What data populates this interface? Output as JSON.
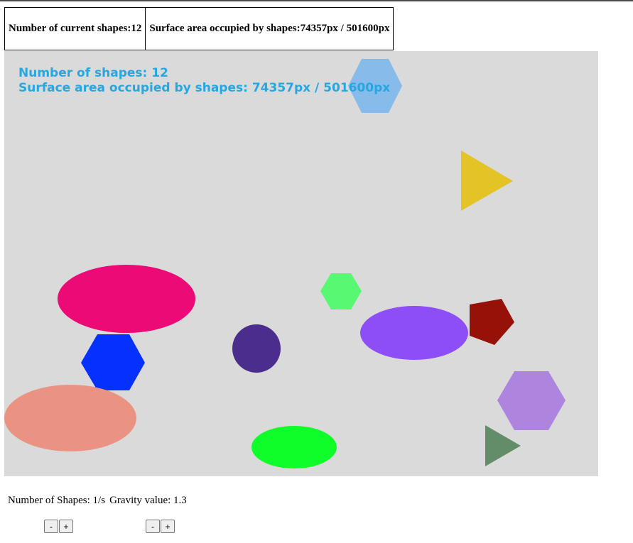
{
  "stats": {
    "shapes_label": "Number of current shapes:",
    "shapes_value": "12",
    "area_label": "Surface area occupied by shapes:",
    "area_value": "74357px / 501600px"
  },
  "overlay": {
    "line1": "Number of shapes: 12",
    "line2": "Surface area occupied by shapes: 74357px / 501600px"
  },
  "colors": {
    "canvas_background": "#dadada",
    "overlay_text": "#27a6e0"
  },
  "shapes": [
    {
      "kind": "hexagon",
      "name": "light-blue-hexagon",
      "color": "#87bbe9"
    },
    {
      "kind": "triangle",
      "name": "yellow-triangle",
      "color": "#e3c325"
    },
    {
      "kind": "ellipse",
      "name": "pink-ellipse",
      "color": "#ec0a76"
    },
    {
      "kind": "hexagon",
      "name": "light-green-hexagon",
      "color": "#58f872"
    },
    {
      "kind": "ellipse",
      "name": "purple-ellipse",
      "color": "#8d4ef7"
    },
    {
      "kind": "pentagon",
      "name": "dark-red-pentagon",
      "color": "#961209"
    },
    {
      "kind": "hexagon",
      "name": "blue-hexagon",
      "color": "#0530fd"
    },
    {
      "kind": "circle",
      "name": "indigo-circle",
      "color": "#4a2d8d"
    },
    {
      "kind": "ellipse",
      "name": "salmon-ellipse",
      "color": "#ea9383"
    },
    {
      "kind": "hexagon",
      "name": "lavender-hexagon",
      "color": "#ad85de"
    },
    {
      "kind": "ellipse",
      "name": "green-ellipse",
      "color": "#0ffd29"
    },
    {
      "kind": "triangle",
      "name": "green-gray-triangle",
      "color": "#628d68"
    }
  ],
  "controls": {
    "shapes_label": "Number of Shapes: 1/s",
    "gravity_label": "Gravity value: 1.3",
    "minus": "-",
    "plus": "+"
  }
}
